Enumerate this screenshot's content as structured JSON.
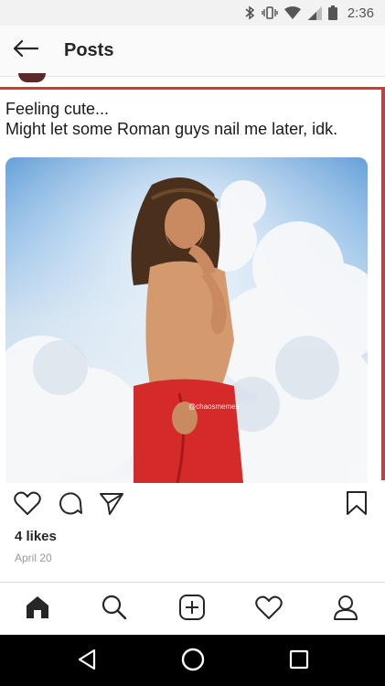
{
  "status_bar": {
    "time": "2:36",
    "icons": [
      "bluetooth-icon",
      "vibrate-icon",
      "wifi-icon",
      "signal-icon",
      "battery-icon"
    ]
  },
  "header": {
    "title": "Posts",
    "back_icon": "arrow-left-icon"
  },
  "post": {
    "caption_line1": "Feeling cute...",
    "caption_line2": "Might let some Roman guys nail me later, idk.",
    "image_watermark": "@chaosmemes",
    "accent_color": "#d23a3a",
    "likes": "4 likes",
    "date": "April 20",
    "actions": [
      "heart-icon",
      "comment-icon",
      "share-icon",
      "bookmark-icon"
    ]
  },
  "tab_bar": {
    "tabs": [
      "home-icon",
      "search-icon",
      "add-post-icon",
      "activity-heart-icon",
      "profile-icon"
    ]
  },
  "nav_bar": {
    "buttons": [
      "back-triangle-icon",
      "home-circle-icon",
      "recents-square-icon"
    ]
  }
}
